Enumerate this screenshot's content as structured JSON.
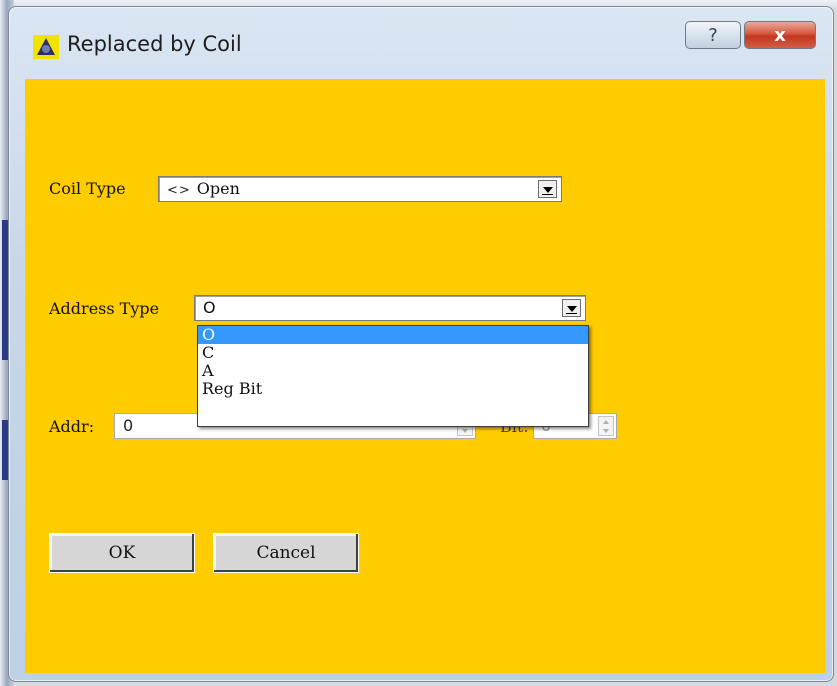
{
  "window": {
    "title": "Replaced by Coil",
    "help_glyph": "?",
    "close_glyph": "x"
  },
  "coil_type": {
    "label": "Coil Type",
    "symbol": "<>",
    "value": "Open"
  },
  "address_type": {
    "label": "Address Type",
    "value": "O",
    "options": [
      "O",
      "C",
      "A",
      "Reg Bit"
    ],
    "selected_index": 0
  },
  "addr": {
    "label": "Addr:",
    "value": "0"
  },
  "bit": {
    "label": "Bit:",
    "value": "0"
  },
  "buttons": {
    "ok": "OK",
    "cancel": "Cancel"
  },
  "colors": {
    "client_background": "#ffcc00",
    "selection": "#3399ff"
  },
  "icons": {
    "app": "app-icon",
    "help": "help-icon",
    "close": "close-icon",
    "dropdown": "chevron-down-icon",
    "spinner": "spinner-icon"
  }
}
